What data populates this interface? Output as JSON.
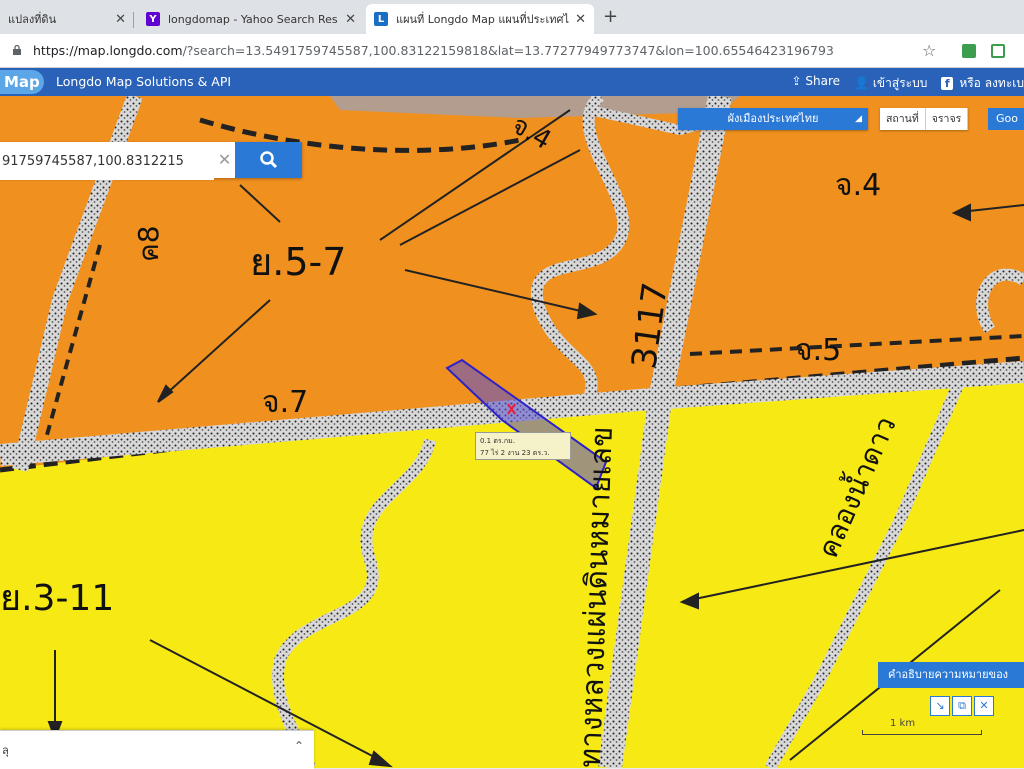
{
  "browser": {
    "tabs": [
      {
        "title": "แปลงที่ดิน",
        "favicon": "page-icon"
      },
      {
        "title": "longdomap - Yahoo Search Res",
        "favicon": "yahoo-icon"
      },
      {
        "title": "แผนที่ Longdo Map แผนที่ประเทศไ",
        "favicon": "longdo-icon",
        "active": true
      }
    ],
    "url_host": "https://map.longdo.com",
    "url_path": "/?search=13.5491759745587,100.83122159818&lat=13.77277949773747&lon=100.65546423196793"
  },
  "header": {
    "logo": "Map",
    "title": "Longdo Map Solutions & API",
    "share": "Share",
    "login": "เข้าสู่ระบบ",
    "or": "หรือ ลงทะเบ"
  },
  "search": {
    "value": "91759745587,100.8312215"
  },
  "layer_select": {
    "label": "ผังเมืองประเทศไทย"
  },
  "modes": [
    "สถานที่",
    "จราจร"
  ],
  "google_button": "Goo",
  "map_labels": {
    "zone_north": "ย.5-7",
    "zone_south": "ย.3-11",
    "road_number": "3117",
    "tag_ch4_top": "จ.4",
    "tag_ch4_right": "จ.4",
    "tag_kho8": "ค8",
    "tag_ch5": "จ.5",
    "tag_ch7": "จ.7",
    "road_name": "ทางหลวงแผ่นดินหมายเลข",
    "canal_name": "คลองน้ำดาว"
  },
  "tooltip": {
    "line1": "0.1 ตร.กม.",
    "line2": "77 ไร่ 2 งาน 23 ตร.ว."
  },
  "legend_button": "คำอธิบายความหมายของ",
  "tools": [
    "draw-line-icon",
    "edit-icon",
    "clear-icon"
  ],
  "scale": "1 km",
  "bottom_panel": {
    "label": "ลุ"
  },
  "colors": {
    "accent": "#2b79d6",
    "header": "#2a62b9",
    "zone_orange": "#f0901f",
    "zone_yellow": "#f7ea14",
    "polygon": "#5a4fd0"
  }
}
